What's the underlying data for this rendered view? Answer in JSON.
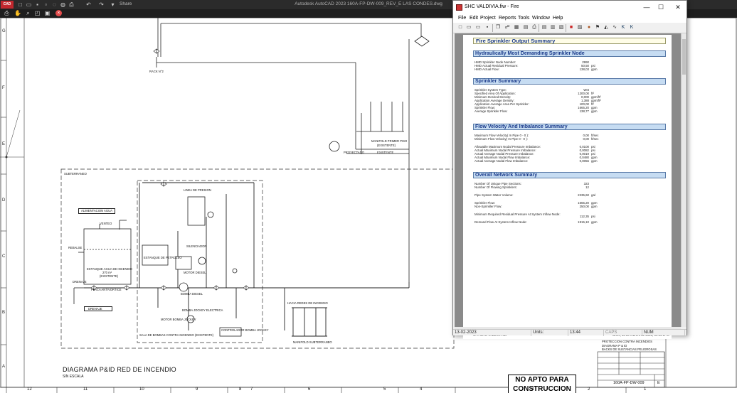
{
  "acad": {
    "logo": "CAD",
    "title": "Autodesk AutoCAD 2023   160A-FP-DW-009_REV_E LAS CONDES.dwg",
    "share": "Share",
    "row_letters": [
      "G",
      "F",
      "E",
      "D",
      "C",
      "B",
      "A"
    ],
    "col_numbers": [
      "12",
      "11",
      "10",
      "9",
      "8",
      "7",
      "6",
      "5",
      "4",
      "3",
      "2",
      "1"
    ],
    "diagram_title": "DIAGRAMA P&ID RED DE INCENDIO",
    "diagram_subtitle": "SIN ESCALA",
    "stamp_line1": "NO APTO PARA",
    "stamp_line2": "CONSTRUCCION",
    "labels": {
      "rack": "RACK N°2",
      "subterraneo": "SUBTERRANEO",
      "manifold_primer": "MANIFOLD PRIMER PISO",
      "manifold_sub": "(EXISTENTE)",
      "proyectado": "PROYECTADO",
      "existente": "EXISTENTE",
      "alimentacion": "ALIMENTACION AGUA",
      "estanque": "ESTANQUE AGUA DE INCENDIO",
      "estanque_cap": "270 m³",
      "estanque_exist": "(EXISTENTE)",
      "placa": "PLACA ANTIVORTICE",
      "drenaje": "DRENAJE",
      "drenaje2": "DRENAJE",
      "linea_presion": "LINEA DE PRESION",
      "hacia_redes": "HACIA REDES DE INCENDIO",
      "manifold_subterraneo": "MANIFOLD SUBTERRANEO",
      "bomba_diesel": "BOMBA DIESEL",
      "bomba_jockey": "BOMBA JOCKEY ELECTRICA",
      "motor_bomba": "MOTOR BOMBA JOCKEY",
      "sala_bombas": "SALA DE BOMBAS CONTRA INCENDIO (EXISTENTE)",
      "controlador": "CONTROLADOR BOMBA JOCKEY",
      "venteo": "VENTEO",
      "rebalse": "REBALSE",
      "estanque_petroleo": "ESTANQUE DE PETROLEO",
      "motor_diesel": "MOTOR DIESEL",
      "silenciador": "SILENCIADOR",
      "ingenieria_1": "INGENIERIA DE DETALLES",
      "ingenieria_2": "PROTECCION CONTRA INCENDIOS",
      "ingenieria_3": "DIAGRAMA P & ID",
      "ingenieria_4": "BACKS DE SUSTANCIAS PELIGROSAS",
      "plano": "160A-FP-DW-009",
      "rev": "E"
    }
  },
  "shc": {
    "window_title": "SHC VALDIVIA.fiw - Fire",
    "menu": [
      {
        "label": "File",
        "key": "F"
      },
      {
        "label": "Edit",
        "key": "E"
      },
      {
        "label": "Project",
        "key": "P"
      },
      {
        "label": "Reports",
        "key": "R"
      },
      {
        "label": "Tools",
        "key": "T"
      },
      {
        "label": "Window",
        "key": "W"
      },
      {
        "label": "Help",
        "key": "H"
      }
    ],
    "report": {
      "main_title": "Fire Sprinkler Output Summary",
      "sections": [
        {
          "title": "Hydraulically Most Demanding Sprinkler Node"
        },
        {
          "title": "Sprinkler Summary"
        },
        {
          "title": "Flow Velocity And Imbalance Summary"
        },
        {
          "title": "Overall Network Summary"
        }
      ],
      "hmd": [
        {
          "label": "HMD Sprinkler Node Number:",
          "value": "2990",
          "unit": ""
        },
        {
          "label": "HMD Actual Residual Pressure:",
          "value": "50,50",
          "unit": "psi"
        },
        {
          "label": "HMD Actual Flow:",
          "value": "138,03",
          "unit": "gpm"
        }
      ],
      "sprinkler": [
        {
          "label": "Sprinkler System Type:",
          "value": "Wet",
          "unit": ""
        },
        {
          "label": "Specified Area Of Application:",
          "value": "1200,00",
          "unit": "ft²"
        },
        {
          "label": "Minimum Desired Density:",
          "value": "0,000",
          "unit": "gpm/ft²"
        },
        {
          "label": "Application Average Density:",
          "value": "1,388",
          "unit": "gpm/ft²"
        },
        {
          "label": "Application Average Area Per Sprinkler:",
          "value": "100,00",
          "unit": "ft²"
        },
        {
          "label": "Sprinkler Flow:",
          "value": "1665,20",
          "unit": "gpm"
        },
        {
          "label": "Average Sprinkler Flow:",
          "value": "138,77",
          "unit": "gpm"
        }
      ],
      "velocity": [
        {
          "label": "Maximum Flow Velocity( In Pipe 0 - 0 ):",
          "value": "0,00",
          "unit": "ft/sec"
        },
        {
          "label": "Minimum Flow Velocity( In Pipe 0 - 0 ):",
          "value": "0,00",
          "unit": "ft/sec"
        },
        {
          "label": "Allowable Maximum Nodal Pressure Imbalance:",
          "value": "0,0100",
          "unit": "psi"
        },
        {
          "label": "Actual Maximum Nodal Pressure Imbalance:",
          "value": "0,0082",
          "unit": "psi"
        },
        {
          "label": "Actual Average Nodal Pressure Imbalance:",
          "value": "0,0019",
          "unit": "psi"
        },
        {
          "label": "Actual Maximum Nodal Flow Imbalance:",
          "value": "0,0480",
          "unit": "gpm"
        },
        {
          "label": "Actual Average Nodal Flow Imbalance:",
          "value": "0,0056",
          "unit": "gpm"
        }
      ],
      "network": [
        {
          "label": "Number Of Unique Pipe Sections:",
          "value": "323",
          "unit": ""
        },
        {
          "label": "Number Of Flowing Sprinklers:",
          "value": "12",
          "unit": ""
        },
        {
          "label": "Pipe System Water Volume:",
          "value": "2235,60",
          "unit": "gal"
        },
        {
          "label": "Sprinkler Flow:",
          "value": "1665,20",
          "unit": "gpm"
        },
        {
          "label": "Non-Sprinkler Flow:",
          "value": "250,00",
          "unit": "gpm"
        },
        {
          "label": "Minimum Required Residual Pressure At System Inflow Node:",
          "value": "112,35",
          "unit": "psi"
        },
        {
          "label": "Demand Flow At System Inflow Node:",
          "value": "1915,10",
          "unit": "gpm"
        }
      ],
      "footer_left": "C:\\...\\SHC VALDIVIA.fiw",
      "footer_right": "lunes, 13 de febrero de 2023, 10:05 a. m."
    },
    "status": {
      "date": "13-02-2023",
      "units_label": "Units:",
      "time": "13:44",
      "caps": "CAPS",
      "num": "NUM"
    }
  }
}
